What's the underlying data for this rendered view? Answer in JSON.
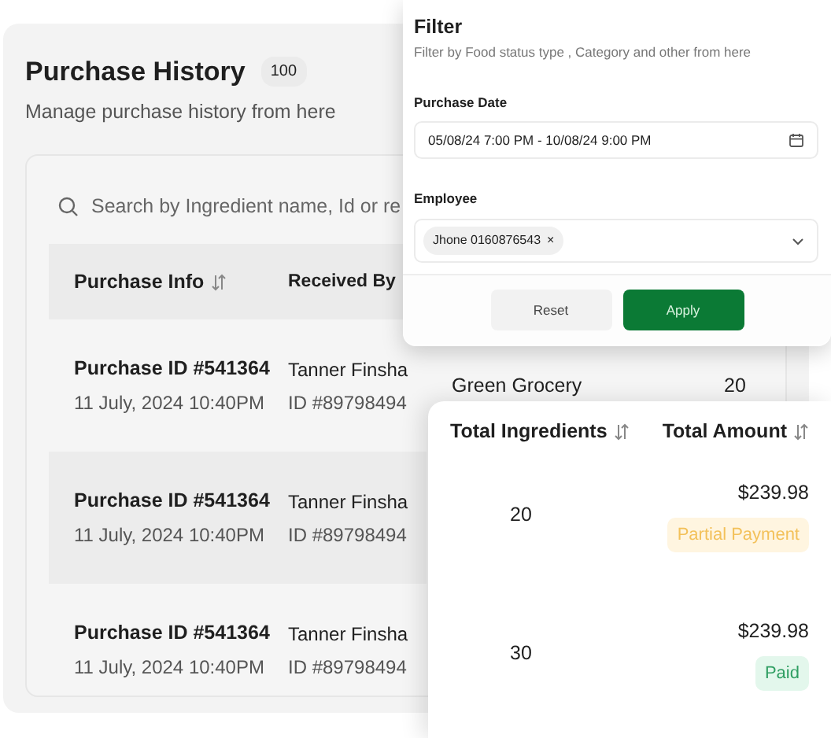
{
  "page": {
    "title": "Purchase History",
    "count": "100",
    "subtitle": "Manage purchase history from here"
  },
  "search": {
    "placeholder": "Search by Ingredient name, Id or re"
  },
  "table": {
    "columns": [
      {
        "label": "Purchase  Info",
        "sortable": true
      },
      {
        "label": "Received By",
        "sortable": false
      }
    ],
    "rows": [
      {
        "purchase_id": "Purchase ID #541364",
        "date": "11 July, 2024 10:40PM",
        "receiver": "Tanner Finsha",
        "receiver_id": "ID #89798494",
        "supplier": "Green Grocery",
        "ingredients": "20",
        "selected": false
      },
      {
        "purchase_id": "Purchase ID #541364",
        "date": "11 July, 2024 10:40PM",
        "receiver": "Tanner Finsha",
        "receiver_id": "ID #89798494",
        "selected": true
      },
      {
        "purchase_id": "Purchase ID #541364",
        "date": "11 July, 2024 10:40PM",
        "receiver": "Tanner Finsha",
        "receiver_id": "ID #89798494",
        "selected": false
      }
    ]
  },
  "filter": {
    "title": "Filter",
    "subtitle": "Filter by Food status type , Category and other from here",
    "date_label": "Purchase Date",
    "date_value": "05/08/24 7:00 PM - 10/08/24 9:00 PM",
    "employee_label": "Employee",
    "employee_tags": [
      "Jhone 0160876543"
    ],
    "tag_remove": "×",
    "buttons": [
      {
        "label": "Reset",
        "kind": "secondary"
      },
      {
        "label": "Apply",
        "kind": "primary"
      }
    ]
  },
  "detail": {
    "columns": [
      {
        "label": "Total Ingredients",
        "sortable": true
      },
      {
        "label": "Total Amount",
        "sortable": true
      }
    ],
    "rows": [
      {
        "ingredients": "20",
        "amount": "$239.98",
        "status": "Partial Payment",
        "kind": "partial"
      },
      {
        "ingredients": "30",
        "amount": "$239.98",
        "status": "Paid",
        "kind": "paid"
      }
    ]
  }
}
